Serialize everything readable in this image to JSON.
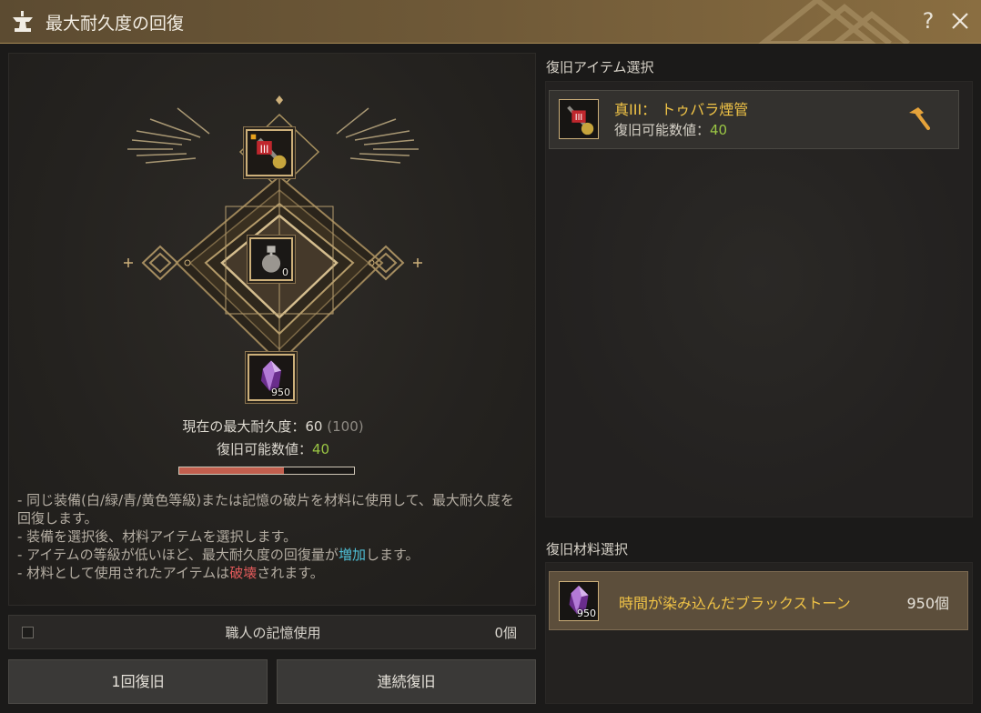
{
  "window": {
    "title": "最大耐久度の回復",
    "help_label": "?",
    "icons": {
      "title": "anvil-icon",
      "close": "close-icon"
    }
  },
  "left": {
    "slots": {
      "target_item_grade": "III",
      "center_count": "0",
      "material_count": "950"
    },
    "stats": {
      "current_max_label": "現在の最大耐久度：",
      "current_max_value": "60",
      "current_max_base": "(100)",
      "recoverable_label": "復旧可能数値：",
      "recoverable_value": "40",
      "progress_fraction": 0.6
    },
    "description": {
      "line1": "- 同じ装備(白/緑/青/黄色等級)または記憶の破片を材料に使用して、最大耐久度を回復します。",
      "line2": "- 装備を選択後、材料アイテムを選択します。",
      "line3_pre": "- アイテムの等級が低いほど、最大耐久度の回復量が",
      "line3_highlight": "増加",
      "line3_post": "します。",
      "line4_pre": "- 材料として使用されたアイテムは",
      "line4_highlight": "破壊",
      "line4_post": "されます。"
    },
    "memory": {
      "label": "職人の記憶使用",
      "count": "0個",
      "checked": false
    },
    "buttons": {
      "once": "1回復旧",
      "continuous": "連続復旧"
    }
  },
  "right": {
    "item_section_title": "復旧アイテム選択",
    "item": {
      "grade": "III",
      "name": "真III： トゥバラ煙管",
      "value_label": "復旧可能数値：",
      "value": "40",
      "action_icon": "hammer-icon"
    },
    "material_section_title": "復旧材料選択",
    "material": {
      "count_badge": "950",
      "name": "時間が染み込んだブラックストーン",
      "count": "950個"
    }
  },
  "colors": {
    "gold": "#cdb07a",
    "item_name": "#f0c346",
    "green_value": "#9ac544",
    "increase": "#4fbfd6",
    "destroy": "#e05a5a",
    "progress": "#c25f4e"
  }
}
